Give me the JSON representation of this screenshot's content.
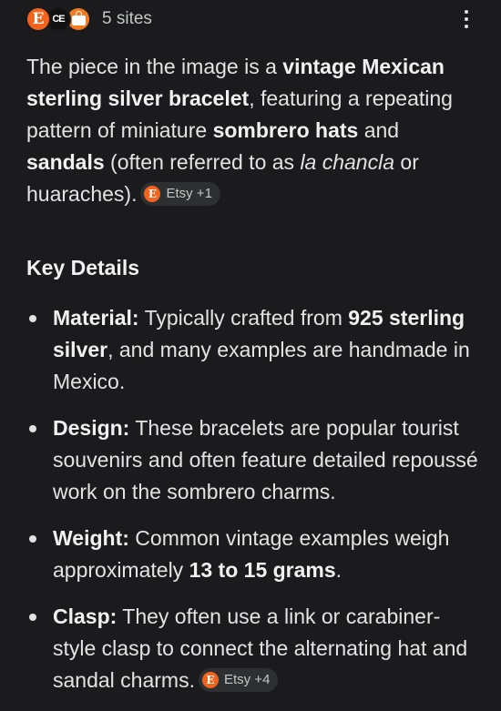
{
  "header": {
    "favicons": [
      {
        "name": "etsy-favicon",
        "glyph": "E",
        "color": "#f1641e"
      },
      {
        "name": "ce-favicon",
        "glyph": "CE",
        "color": "#111111"
      },
      {
        "name": "shop-bag-favicon",
        "glyph": "",
        "color": "#f47a1f"
      }
    ],
    "sites_label": "5 sites",
    "menu_icon": "more-vert-icon"
  },
  "intro": {
    "t1": "The piece in the image is a ",
    "b1": "vintage Mexican sterling silver bracelet",
    "t2": ", featuring a repeating pattern of miniature ",
    "b2": "sombrero hats",
    "t3": " and ",
    "b3": "sandals",
    "t4": " (often referred to as ",
    "i1": "la chancla",
    "t5": " or huaraches).",
    "chip": {
      "icon": "E",
      "label": "Etsy +1"
    }
  },
  "section_title": "Key Details",
  "details": {
    "material": {
      "label": "Material:",
      "t1": " Typically crafted from ",
      "b1": "925 sterling silver",
      "t2": ", and many examples are handmade in Mexico."
    },
    "design": {
      "label": "Design:",
      "t1": " These bracelets are popular tourist souvenirs and often feature detailed repoussé work on the sombrero charms."
    },
    "weight": {
      "label": "Weight:",
      "t1": " Common vintage examples weigh approximately ",
      "b1": "13 to 15 grams",
      "t2": "."
    },
    "clasp": {
      "label": "Clasp:",
      "t1": " They often use a link or carabiner-style clasp to connect the alternating hat and sandal charms.",
      "chip": {
        "icon": "E",
        "label": "Etsy +4"
      }
    }
  }
}
